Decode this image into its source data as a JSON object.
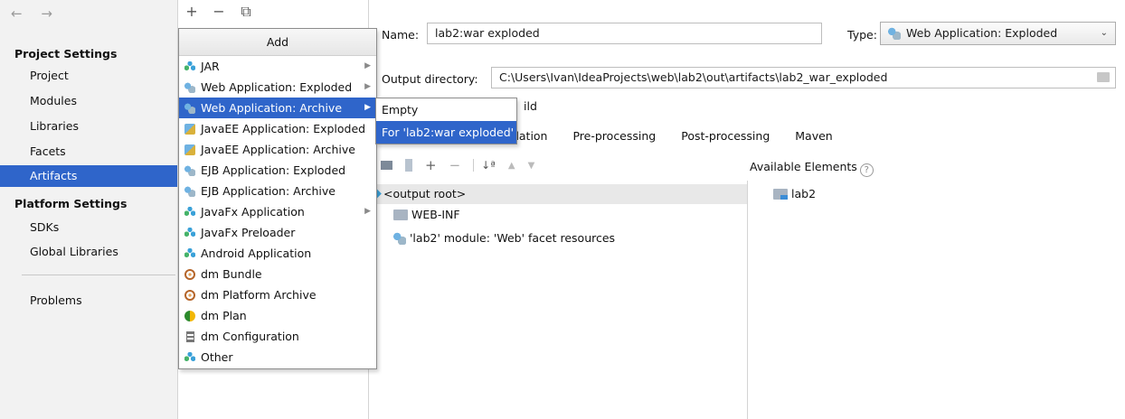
{
  "sidebar": {
    "nav_arrows": "← →",
    "project_settings_title": "Project Settings",
    "project_items": [
      "Project",
      "Modules",
      "Libraries",
      "Facets",
      "Artifacts"
    ],
    "platform_settings_title": "Platform Settings",
    "platform_items": [
      "SDKs",
      "Global Libraries"
    ],
    "problems": "Problems",
    "selected": "Artifacts"
  },
  "artifact_toolbar": {
    "add": "+",
    "remove": "−",
    "copy": "⧉"
  },
  "add_menu": {
    "title": "Add",
    "items": [
      {
        "label": "JAR",
        "icon": "diamonds-icon",
        "submenu": true
      },
      {
        "label": "Web Application: Exploded",
        "icon": "web-icon",
        "submenu": true
      },
      {
        "label": "Web Application: Archive",
        "icon": "web-icon",
        "submenu": true,
        "highlighted": true
      },
      {
        "label": "JavaEE Application: Exploded",
        "icon": "javaee-icon",
        "submenu": false
      },
      {
        "label": "JavaEE Application: Archive",
        "icon": "javaee-icon",
        "submenu": false
      },
      {
        "label": "EJB Application: Exploded",
        "icon": "web-icon",
        "submenu": false
      },
      {
        "label": "EJB Application: Archive",
        "icon": "web-icon",
        "submenu": false
      },
      {
        "label": "JavaFx Application",
        "icon": "diamonds-icon",
        "submenu": true
      },
      {
        "label": "JavaFx Preloader",
        "icon": "diamonds-icon",
        "submenu": false
      },
      {
        "label": "Android Application",
        "icon": "diamonds-icon",
        "submenu": false
      },
      {
        "label": "dm Bundle",
        "icon": "bundle-icon",
        "submenu": false
      },
      {
        "label": "dm Platform Archive",
        "icon": "bundle-icon",
        "submenu": false
      },
      {
        "label": "dm Plan",
        "icon": "plan-icon",
        "submenu": false
      },
      {
        "label": "dm Configuration",
        "icon": "config-icon",
        "submenu": false
      },
      {
        "label": "Other",
        "icon": "diamonds-icon",
        "submenu": false
      }
    ]
  },
  "submenu": {
    "items": [
      "Empty",
      "For 'lab2:war exploded'"
    ],
    "highlighted_index": 1
  },
  "form": {
    "name_label": "Name:",
    "name_value": "lab2:war exploded",
    "type_label": "Type:",
    "type_value": "Web Application: Exploded",
    "output_label": "Output directory:",
    "output_value": "C:\\Users\\Ivan\\IdeaProjects\\web\\lab2\\out\\artifacts\\lab2_war_exploded",
    "build_fragment": "ild"
  },
  "tabs": [
    "lidation",
    "Pre-processing",
    "Post-processing",
    "Maven"
  ],
  "available_elements_label": "Available Elements",
  "help_glyph": "?",
  "tree": {
    "output_root": "<output root>",
    "web_inf": "WEB-INF",
    "facet_resources": "'lab2' module: 'Web' facet resources"
  },
  "available_tree": {
    "lab2": "lab2"
  },
  "colors": {
    "selection": "#2f65ca",
    "menu_border": "#8c8c8c"
  }
}
